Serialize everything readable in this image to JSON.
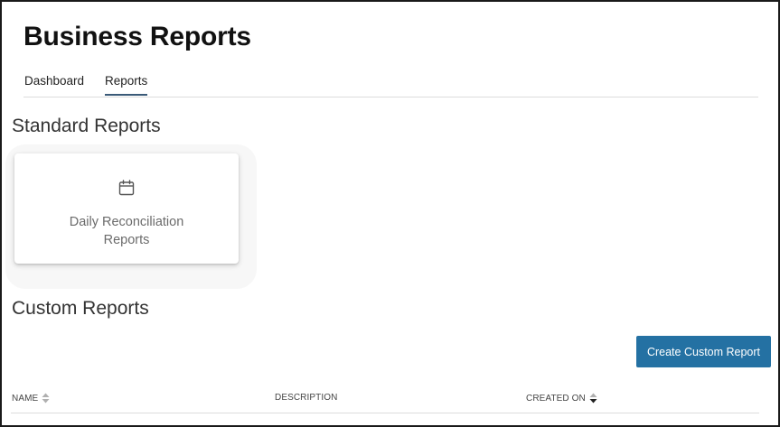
{
  "page": {
    "title": "Business Reports"
  },
  "tabs": [
    {
      "label": "Dashboard",
      "active": false
    },
    {
      "label": "Reports",
      "active": true
    }
  ],
  "standard_reports": {
    "heading": "Standard Reports",
    "cards": [
      {
        "label": "Daily Reconciliation Reports",
        "icon": "calendar-icon"
      }
    ]
  },
  "custom_reports": {
    "heading": "Custom Reports",
    "create_button": "Create Custom Report",
    "columns": [
      {
        "label": "NAME",
        "sortable": true,
        "sort": "none"
      },
      {
        "label": "DESCRIPTION",
        "sortable": false
      },
      {
        "label": "CREATED ON",
        "sortable": true,
        "sort": "descending"
      }
    ]
  },
  "colors": {
    "accent": "#2471a3",
    "tab_underline": "#3a5a78"
  }
}
